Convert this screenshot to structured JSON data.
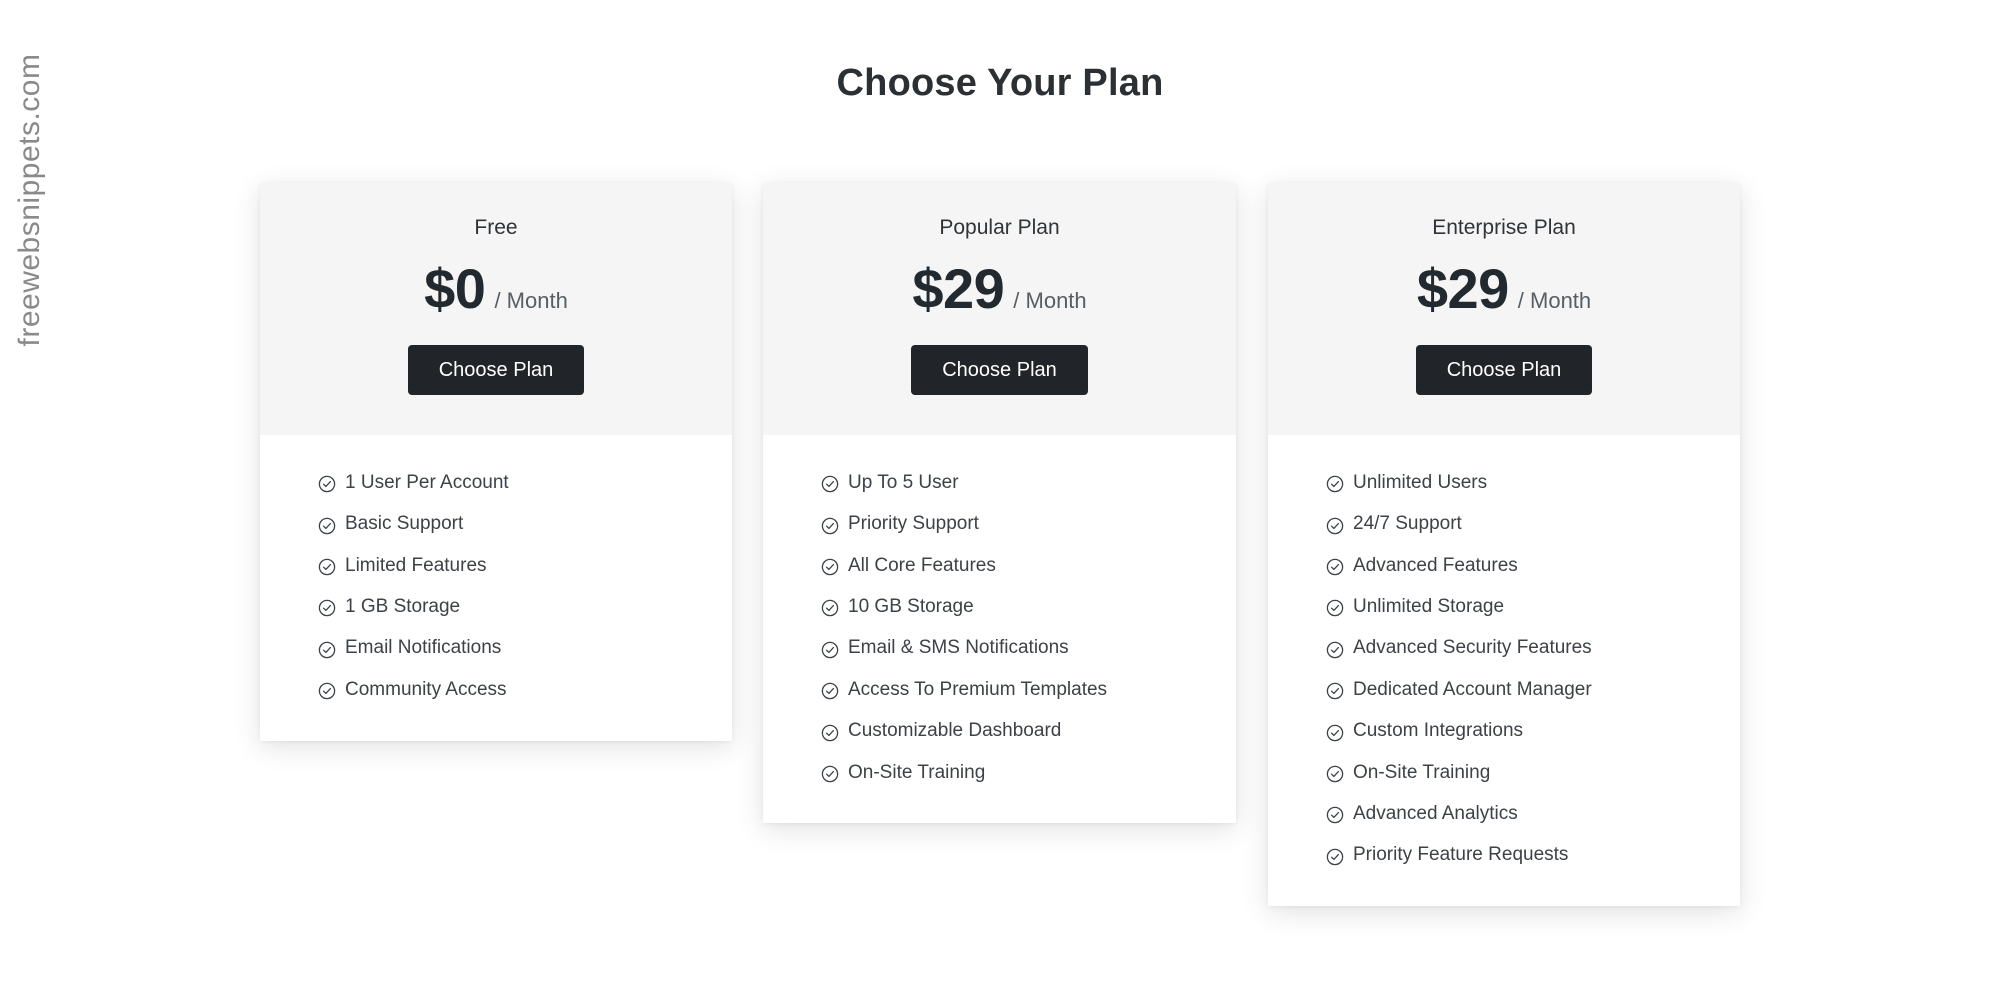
{
  "page": {
    "title": "Choose Your Plan",
    "watermark": "freewebsnippets.com",
    "colors": {
      "background": "#ffffff",
      "card_header": "#f5f5f5",
      "card_body": "#ffffff",
      "button": "#212529",
      "button_text": "#ffffff",
      "title_text": "#2b3035",
      "feature_text": "#3c4247",
      "period_text": "#575e64",
      "watermark_text": "#8a8a8a"
    }
  },
  "plans": [
    {
      "name": "Free",
      "price": "$0",
      "period": "/ Month",
      "cta_label": "Choose Plan",
      "feature_icon": "check-circle-icon",
      "features": [
        "1 User Per Account",
        "Basic Support",
        "Limited Features",
        "1 GB Storage",
        "Email Notifications",
        "Community Access"
      ]
    },
    {
      "name": "Popular Plan",
      "price": "$29",
      "period": "/ Month",
      "cta_label": "Choose Plan",
      "feature_icon": "check-circle-icon",
      "features": [
        "Up To 5 User",
        "Priority Support",
        "All Core Features",
        "10 GB Storage",
        "Email & SMS Notifications",
        "Access To Premium Templates",
        "Customizable Dashboard",
        "On-Site Training"
      ]
    },
    {
      "name": "Enterprise Plan",
      "price": "$29",
      "period": "/ Month",
      "cta_label": "Choose Plan",
      "feature_icon": "check-circle-icon",
      "features": [
        "Unlimited Users",
        "24/7 Support",
        "Advanced Features",
        "Unlimited Storage",
        "Advanced Security Features",
        "Dedicated Account Manager",
        "Custom Integrations",
        "On-Site Training",
        "Advanced Analytics",
        "Priority Feature Requests"
      ]
    }
  ]
}
